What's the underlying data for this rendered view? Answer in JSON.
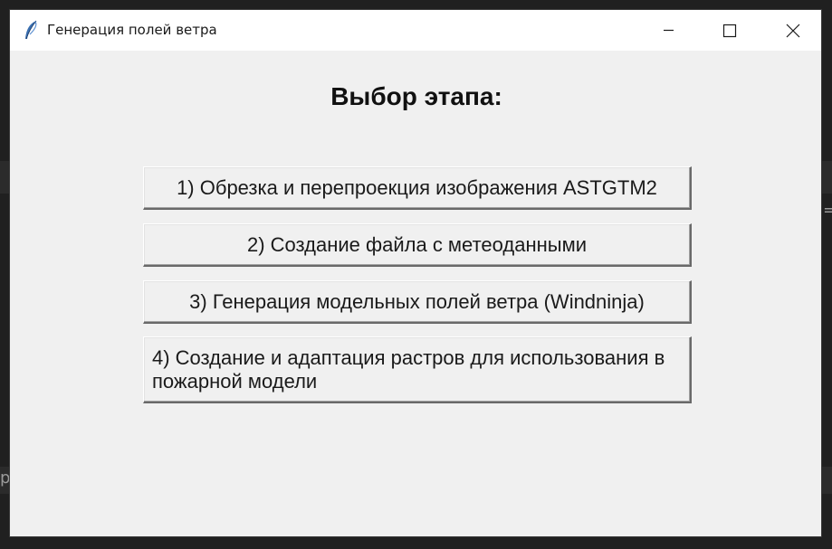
{
  "window": {
    "title": "Генерация полей ветра",
    "controls": {
      "minimize_icon": "minimize-icon",
      "maximize_icon": "maximize-icon",
      "close_icon": "close-icon"
    }
  },
  "main": {
    "heading": "Выбор этапа:",
    "buttons": [
      {
        "label": "1) Обрезка и перепроекция изображения ASTGTM2"
      },
      {
        "label": "2) Создание файла с метеоданными"
      },
      {
        "label": "3) Генерация модельных полей ветра (Windninja)"
      },
      {
        "label": "4) Создание и адаптация растров для использования в пожарной модели"
      }
    ]
  },
  "colors": {
    "window_background": "#f0f0f0",
    "titlebar_background": "#ffffff",
    "desktop_background": "#202020",
    "text": "#1a1a1a"
  }
}
